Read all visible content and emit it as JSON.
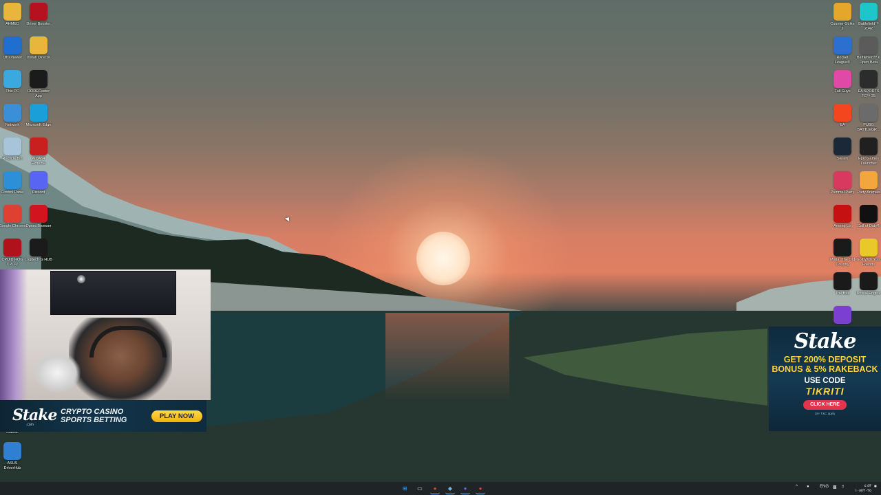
{
  "desktop": {
    "left_icons": [
      {
        "label": "AHMED",
        "icon": "folder-icon",
        "color": "#e8b63a"
      },
      {
        "label": "Driver Booster",
        "icon": "driver-booster-icon",
        "color": "#b3121e"
      },
      {
        "label": "UltraViewer",
        "icon": "ultraviewer-icon",
        "color": "#1f6fd1"
      },
      {
        "label": "Install DirectX",
        "icon": "folder-icon",
        "color": "#e8b63a"
      },
      {
        "label": "This PC",
        "icon": "monitor-icon",
        "color": "#3aa9e0"
      },
      {
        "label": "RODECaster App",
        "icon": "rodecaster-icon",
        "color": "#1b1b1b"
      },
      {
        "label": "Network",
        "icon": "network-icon",
        "color": "#3a8fd6"
      },
      {
        "label": "Microsoft Edge",
        "icon": "edge-icon",
        "color": "#1b9fd8"
      },
      {
        "label": "Recycle Bin",
        "icon": "recycle-bin-icon",
        "color": "#a7c4d8"
      },
      {
        "label": "AIDA64 Extreme",
        "icon": "aida64-icon",
        "color": "#c7201f"
      },
      {
        "label": "Control Panel",
        "icon": "control-panel-icon",
        "color": "#2d8fd8"
      },
      {
        "label": "Discord",
        "icon": "discord-icon",
        "color": "#5865f2"
      },
      {
        "label": "Google Chrome",
        "icon": "chrome-icon",
        "color": "#de4032"
      },
      {
        "label": "Opera Browser",
        "icon": "opera-icon",
        "color": "#d1141d"
      },
      {
        "label": "CPUID ROG CPU-Z",
        "icon": "cpuz-icon",
        "color": "#b0121b"
      },
      {
        "label": "Logitech G HUB",
        "icon": "logitech-icon",
        "color": "#1b1b1b"
      },
      {
        "label": "Classic",
        "icon": "classic-icon",
        "color": "#555555"
      },
      {
        "label": "ASUS DriverHub",
        "icon": "asus-driverhub-icon",
        "color": "#2f7fd3"
      }
    ],
    "right_icons": [
      {
        "label": "Counter-Strike 2",
        "icon": "counter-strike-icon",
        "color": "#e5a72b"
      },
      {
        "label": "Battlefield™ 2042",
        "icon": "battlefield-2042-icon",
        "color": "#1cc6c9"
      },
      {
        "label": "Rocket League®",
        "icon": "rocket-league-icon",
        "color": "#2b6fd1"
      },
      {
        "label": "Battlefield™ 6 Open Beta",
        "icon": "battlefield-6-icon",
        "color": "#5b5b5b"
      },
      {
        "label": "Fall Guys",
        "icon": "fall-guys-icon",
        "color": "#e04aa6"
      },
      {
        "label": "EA SPORTS FC™ 25",
        "icon": "ea-fc-icon",
        "color": "#2c2c2c"
      },
      {
        "label": "EA",
        "icon": "ea-icon",
        "color": "#f3461f"
      },
      {
        "label": "PUBG BATTLEGR...",
        "icon": "pubg-icon",
        "color": "#6b6b6b"
      },
      {
        "label": "Steam",
        "icon": "steam-icon",
        "color": "#1b2838"
      },
      {
        "label": "Epic Games Launcher",
        "icon": "epic-games-icon",
        "color": "#202020"
      },
      {
        "label": "Pummel Party",
        "icon": "pummel-party-icon",
        "color": "#d8395f"
      },
      {
        "label": "Party Animals",
        "icon": "party-animals-icon",
        "color": "#f3a640"
      },
      {
        "label": "Among Us",
        "icon": "among-us-icon",
        "color": "#c51111"
      },
      {
        "label": "Call of Duty®",
        "icon": "call-of-duty-icon",
        "color": "#111111"
      },
      {
        "label": "Mafia: The Old Country",
        "icon": "mafia-icon",
        "color": "#1a1a1a"
      },
      {
        "label": "Golf With Your Friends",
        "icon": "golf-icon",
        "color": "#e9c92a"
      },
      {
        "label": "The Bus",
        "icon": "the-bus-icon",
        "color": "#1a1a1a"
      },
      {
        "label": "Unreal Engine",
        "icon": "unreal-engine-icon",
        "color": "#1a1a1a"
      },
      {
        "label": "",
        "icon": "game-icon",
        "color": "#7b3fd1"
      }
    ]
  },
  "webcam_banner": {
    "logo": "Stake",
    "logo_sub": ".com",
    "tagline": "CRYPTO CASINO SPORTS BETTING",
    "button": "PLAY NOW"
  },
  "stake_ad": {
    "logo": "Stake",
    "headline": "GET 200% DEPOSIT BONUS & 5% RAKEBACK",
    "use_code_label": "USE CODE",
    "code": "TIKRITI",
    "button": "CLICK HERE",
    "fine_print": "18+ T&C apply"
  },
  "taskbar": {
    "apps": [
      {
        "name": "start-button",
        "glyph": "⊞",
        "color": "#3b9cf0"
      },
      {
        "name": "task-view",
        "glyph": "▭",
        "color": "#c9c9c9"
      },
      {
        "name": "chrome",
        "glyph": "●",
        "color": "#de4032"
      },
      {
        "name": "steam",
        "glyph": "◆",
        "color": "#6fb1e0"
      },
      {
        "name": "discord",
        "glyph": "●",
        "color": "#5865f2"
      },
      {
        "name": "app",
        "glyph": "●",
        "color": "#e53a3a"
      }
    ],
    "tray": {
      "chevron": "^",
      "language": "ENG",
      "time": "٤:٥٣",
      "date": "١٠/٨/٢٠٢٥"
    }
  }
}
